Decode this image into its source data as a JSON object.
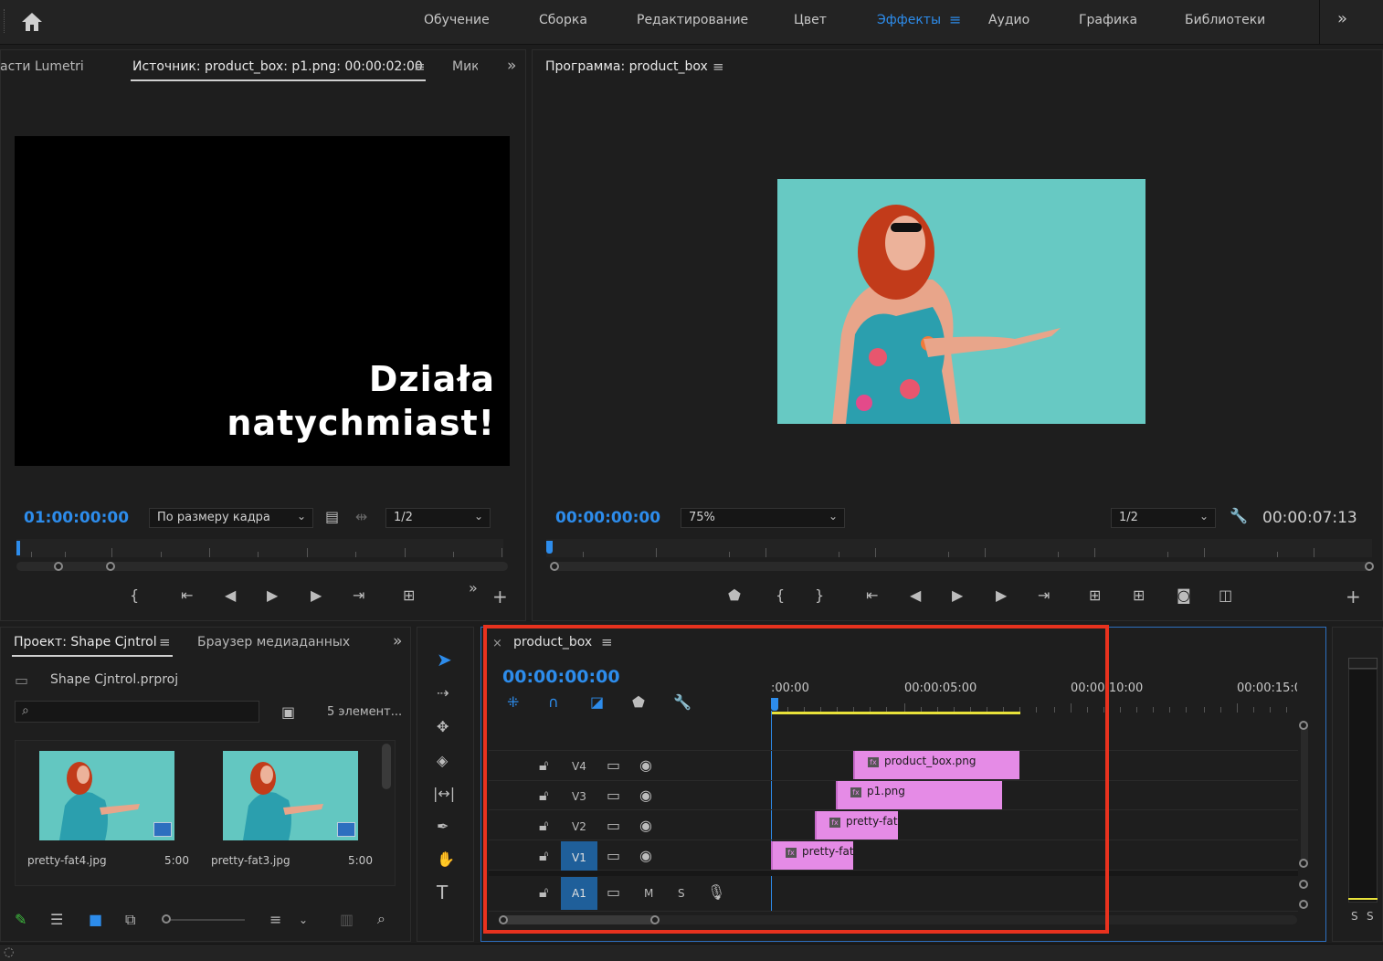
{
  "topbar": {
    "workspaces": [
      {
        "label": "Обучение"
      },
      {
        "label": "Сборка"
      },
      {
        "label": "Редактирование"
      },
      {
        "label": "Цвет"
      },
      {
        "label": "Эффекты"
      },
      {
        "label": "Аудио"
      },
      {
        "label": "Графика"
      },
      {
        "label": "Библиотеки"
      }
    ],
    "active_workspace": "Эффекты"
  },
  "source_panel": {
    "tabs": [
      "асти Lumetri",
      "Источник: product_box: p1.png: 00:00:02:00",
      "Мик"
    ],
    "overlay_line1": "Działa",
    "overlay_line2": "natychmiast!",
    "timecode": "01:00:00:00",
    "fit_select": "По размеру кадра",
    "resolution_select": "1/2"
  },
  "program_panel": {
    "tab": "Программа: product_box",
    "timecode": "00:00:00:00",
    "zoom_select": "75%",
    "resolution_select": "1/2",
    "duration": "00:00:07:13"
  },
  "project_panel": {
    "tabs": [
      "Проект: Shape Cjntrol",
      "Браузер медиаданных"
    ],
    "project_file": "Shape Cjntrol.prproj",
    "item_count": "5 элемент...",
    "items": [
      {
        "name": "pretty-fat4.jpg",
        "duration": "5:00"
      },
      {
        "name": "pretty-fat3.jpg",
        "duration": "5:00"
      }
    ]
  },
  "timeline": {
    "close_label": "×",
    "sequence_name": "product_box",
    "timecode": "00:00:00:00",
    "ruler_labels": [
      ":00:00",
      "00:00:05:00",
      "00:00:10:00",
      "00:00:15:0"
    ],
    "tracks": [
      {
        "name": "V4",
        "clip": "product_box.png"
      },
      {
        "name": "V3",
        "clip": "p1.png"
      },
      {
        "name": "V2",
        "clip": "pretty-fat"
      },
      {
        "name": "V1",
        "clip": "pretty-fat"
      }
    ],
    "audio_track": {
      "name": "A1",
      "m": "M",
      "s": "S"
    }
  },
  "meter": {
    "s1": "S",
    "s2": "S"
  },
  "colors": {
    "accent": "#2d8ceb",
    "clip": "#e58be6",
    "highlight_box": "#e8321e",
    "work_area": "#e8e23a"
  }
}
